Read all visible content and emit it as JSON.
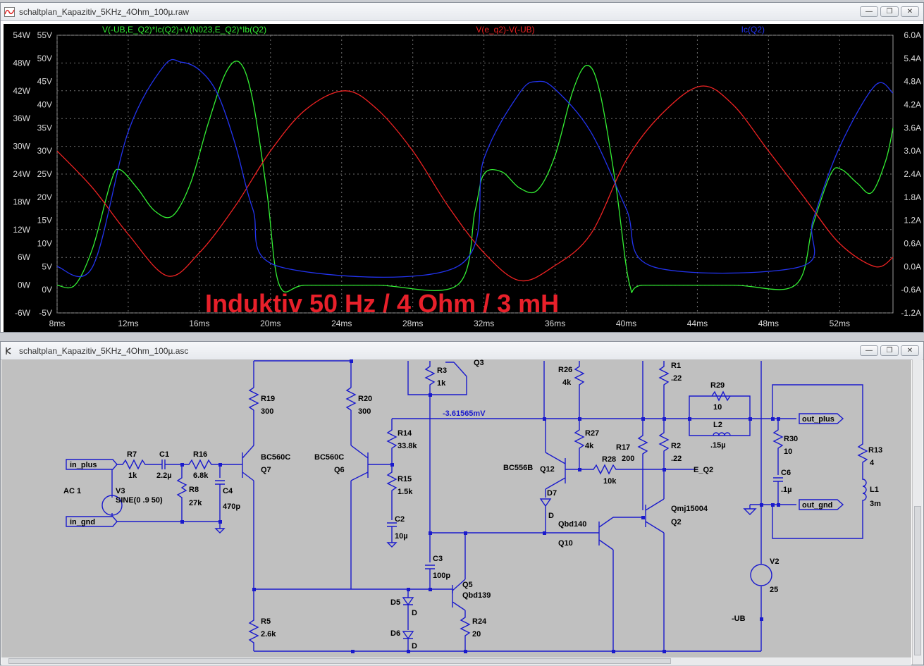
{
  "waveform_window": {
    "title": "schaltplan_Kapazitiv_5KHz_4Ohm_100µ.raw",
    "traces": [
      {
        "label": "V(-UB,E_Q2)*Ic(Q2)+V(N023,E_Q2)*Ib(Q2)",
        "color": "#33ee33"
      },
      {
        "label": "V(e_q2)-V(-UB)",
        "color": "#ee2222"
      },
      {
        "label": "Ic(Q2)",
        "color": "#2233ee"
      }
    ],
    "overlay_label": "Induktiv 50 Hz / 4 Ohm / 3 mH",
    "overlay_color": "#e8202a"
  },
  "schematic_window": {
    "title": "schaltplan_Kapazitiv_5KHz_4Ohm_100µ.asc",
    "wire_color": "#1a1acc",
    "labels": {
      "R19": "R19",
      "R19v": "300",
      "R20": "R20",
      "R20v": "300",
      "R3": "R3",
      "R3v": "1k",
      "Q3": "Q3",
      "R26": "R26",
      "R26v": "4k",
      "R1": "R1",
      "R1v": ".22",
      "R29": "R29",
      "R29v": "10",
      "L2": "L2",
      "L2v": ".15µ",
      "node_voltage": "-3.61565mV",
      "R14": "R14",
      "R14v": "33.8k",
      "R15": "R15",
      "R15v": "1.5k",
      "C2": "C2",
      "C2v": "10µ",
      "R27": "R27",
      "R27v": "4k",
      "R17": "R17",
      "R17v": "200",
      "R2": "R2",
      "R2v": ".22",
      "R28": "R28",
      "R28v": "10k",
      "R30": "R30",
      "R30v": "10",
      "C6": "C6",
      "C6v": ".1µ",
      "R13": "R13",
      "R13v": "4",
      "L1": "L1",
      "L1v": "3m",
      "in_plus": "in_plus",
      "in_gnd": "in_gnd",
      "out_plus": "out_plus",
      "out_gnd": "out_gnd",
      "E_Q2": "E_Q2",
      "AC": "AC 1",
      "V3": "V3",
      "V3v": "SINE(0 .9 50)",
      "R7": "R7",
      "R7v": "1k",
      "C1": "C1",
      "C1v": "2.2µ",
      "R16": "R16",
      "R16v": "6.8k",
      "R8": "R8",
      "R8v": "27k",
      "C4": "C4",
      "C4v": "470p",
      "BC560C_a": "BC560C",
      "Q7": "Q7",
      "BC560C_b": "BC560C",
      "Q6": "Q6",
      "BC556B": "BC556B",
      "Q12": "Q12",
      "D7": "D7",
      "D7v": "D",
      "Qbd140": "Qbd140",
      "Q10": "Q10",
      "Qmj15004": "Qmj15004",
      "Q2": "Q2",
      "C3": "C3",
      "C3v": "100p",
      "Q5": "Q5",
      "Qbd139": "Qbd139",
      "D5": "D5",
      "D5v": "D",
      "D6": "D6",
      "D6v": "D",
      "R5": "R5",
      "R5v": "2.6k",
      "R24": "R24",
      "R24v": "20",
      "V2": "V2",
      "V2v": "25",
      "UB": "-UB"
    }
  },
  "chart_data": {
    "type": "line",
    "x": {
      "label": "",
      "unit": "ms",
      "range": [
        8,
        55
      ],
      "ticks": [
        "8ms",
        "12ms",
        "16ms",
        "20ms",
        "24ms",
        "28ms",
        "32ms",
        "36ms",
        "40ms",
        "44ms",
        "48ms",
        "52ms"
      ]
    },
    "y_left_outer": {
      "unit": "W",
      "range": [
        -6,
        54
      ],
      "ticks": [
        "54W",
        "48W",
        "42W",
        "36W",
        "30W",
        "24W",
        "18W",
        "12W",
        "6W",
        "0W",
        "-6W"
      ]
    },
    "y_left_inner": {
      "unit": "V",
      "range": [
        -5,
        55
      ],
      "ticks": [
        "55V",
        "50V",
        "45V",
        "40V",
        "35V",
        "30V",
        "25V",
        "20V",
        "15V",
        "10V",
        "5V",
        "0V",
        "-5V"
      ]
    },
    "y_right": {
      "unit": "A",
      "range": [
        -1.2,
        6.0
      ],
      "ticks": [
        "6.0A",
        "5.4A",
        "4.8A",
        "4.2A",
        "3.6A",
        "3.0A",
        "2.4A",
        "1.8A",
        "1.2A",
        "0.6A",
        "0.0A",
        "-0.6A",
        "-1.2A"
      ]
    },
    "grid": true,
    "series": [
      {
        "name": "V(-UB,E_Q2)*Ic(Q2)+V(N023,E_Q2)*Ib(Q2)",
        "axis": "W",
        "x": [
          8.0,
          9.0,
          10.0,
          11.0,
          11.5,
          12.5,
          13.5,
          14.5,
          15.5,
          16.5,
          17.5,
          18.3,
          19.0,
          19.8,
          20.5,
          22,
          26,
          30.5,
          31.5,
          32.0,
          33.0,
          34.0,
          35.0,
          36.0,
          37.0,
          37.8,
          38.5,
          39.4,
          40.2,
          41,
          46,
          49.5,
          50.5,
          51.5,
          52.1,
          53.0,
          53.8,
          54.6,
          55.0
        ],
        "y": [
          0,
          0,
          8,
          22,
          25,
          21,
          16,
          15,
          22,
          35,
          46,
          48,
          40,
          20,
          0,
          0,
          0,
          0,
          16,
          24,
          24.5,
          21,
          20.5,
          28,
          42,
          47.5,
          42,
          22,
          0,
          0,
          0,
          0,
          13,
          24,
          25,
          22,
          20,
          27,
          34
        ]
      },
      {
        "name": "V(e_q2)-V(-UB)",
        "axis": "V",
        "x": [
          8,
          10,
          12,
          14.2,
          16,
          18,
          20,
          22,
          24.2,
          26,
          28,
          30,
          32,
          34,
          35.9,
          38,
          40,
          42,
          44.2,
          46,
          48,
          50,
          52,
          54,
          55
        ],
        "y": [
          30,
          22,
          12,
          3,
          8,
          18,
          30,
          39,
          43,
          39,
          30,
          18,
          8,
          2,
          5,
          12,
          28,
          38,
          44,
          40,
          30,
          20,
          10,
          5,
          7
        ]
      },
      {
        "name": "Ic(Q2)",
        "axis": "A",
        "x": [
          8,
          10,
          12,
          14,
          15,
          16,
          17,
          18,
          19,
          20.5,
          30.5,
          32,
          34,
          35,
          36,
          38,
          40,
          41.5,
          49.8,
          50.5,
          52,
          54,
          55
        ],
        "y": [
          0,
          0,
          3.5,
          5.2,
          5.3,
          5.1,
          4.5,
          3.2,
          1.5,
          0,
          0,
          2.8,
          4.5,
          4.8,
          4.6,
          3.5,
          1.5,
          0,
          0,
          1.2,
          3.1,
          4.7,
          4.5
        ]
      }
    ]
  }
}
